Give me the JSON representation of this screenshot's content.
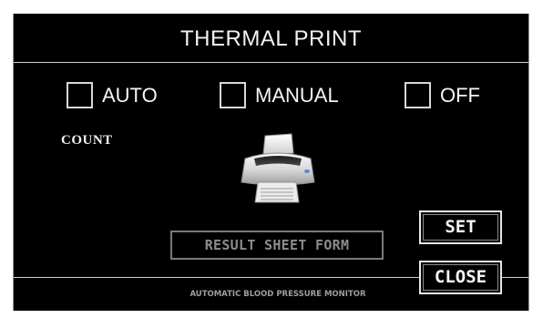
{
  "screen": {
    "title": "THERMAL PRINT",
    "footer": "AUTOMATIC BLOOD PRESSURE MONITOR"
  },
  "print_mode": {
    "options": [
      {
        "label": "AUTO",
        "checked": false
      },
      {
        "label": "MANUAL",
        "checked": false
      },
      {
        "label": "OFF",
        "checked": false
      }
    ]
  },
  "count": {
    "label": "COUNT"
  },
  "printer": {
    "icon": "printer-icon"
  },
  "buttons": {
    "result_sheet_form": "RESULT SHEET FORM",
    "set": "SET",
    "close": "CLOSE"
  },
  "colors": {
    "background": "#000000",
    "text": "#f2f2f2",
    "disabled_text": "#8c8c8c",
    "border": "#d8d8d8"
  }
}
